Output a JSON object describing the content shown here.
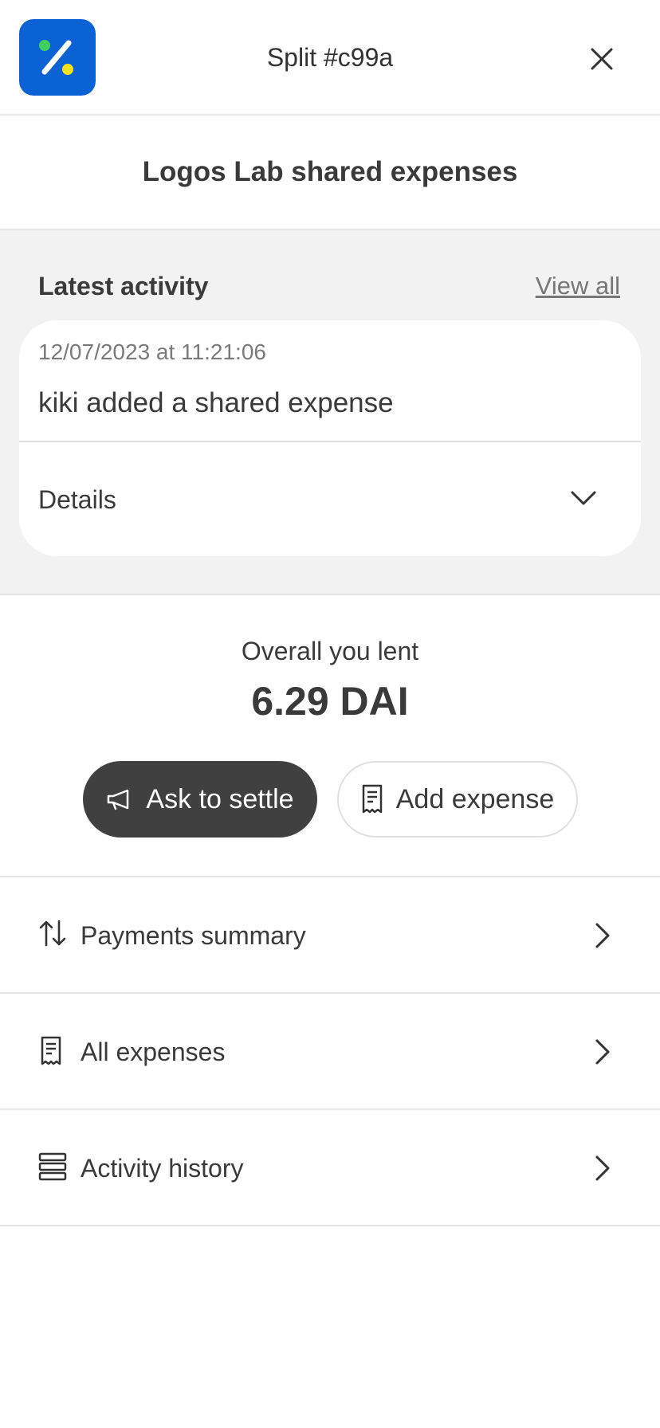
{
  "header": {
    "title": "Split #c99a",
    "logo_icon": "percent-logo-icon",
    "close_icon": "close-icon",
    "colors": {
      "logo_bg": "#0a62d4",
      "logo_dot_green": "#3ecf5e",
      "logo_dot_yellow": "#f4e21a"
    }
  },
  "group": {
    "name": "Logos Lab shared expenses"
  },
  "latest_activity": {
    "heading": "Latest activity",
    "view_all": "View all",
    "item": {
      "timestamp": "12/07/2023 at 11:21:06",
      "description": "kiki added a shared expense",
      "details_label": "Details"
    }
  },
  "balance": {
    "label": "Overall you lent",
    "amount": "6.29 DAI"
  },
  "actions": {
    "settle_label": "Ask to settle",
    "settle_icon": "megaphone-icon",
    "add_label": "Add expense",
    "add_icon": "receipt-icon"
  },
  "nav": [
    {
      "label": "Payments summary",
      "icon": "arrows-up-down-icon"
    },
    {
      "label": "All expenses",
      "icon": "receipt-icon"
    },
    {
      "label": "Activity history",
      "icon": "stack-list-icon"
    }
  ]
}
